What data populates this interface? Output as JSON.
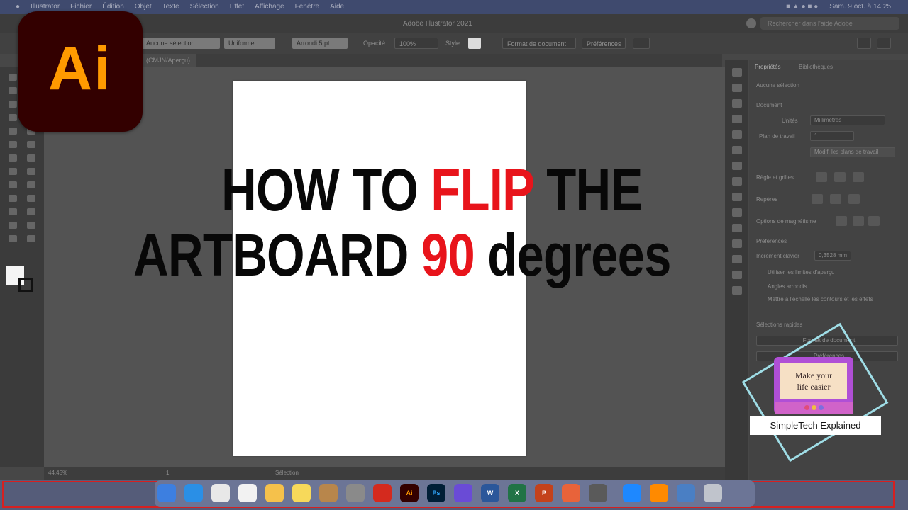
{
  "menubar": {
    "apple": "",
    "items": [
      "Illustrator",
      "Fichier",
      "Édition",
      "Objet",
      "Texte",
      "Sélection",
      "Effet",
      "Affichage",
      "Fenêtre",
      "Aide"
    ],
    "datetime": "Sam. 9 oct. à 14:25"
  },
  "window": {
    "title": "Adobe Illustrator 2021",
    "search_placeholder": "Rechercher dans l'aide Adobe"
  },
  "controlbar": {
    "fill_field": "Aucune sélection",
    "stroke_value": "Uniforme",
    "brush_value": "Arrondi 5 pt",
    "opacity_label": "Opacité",
    "opacity_value": "100%",
    "style_label": "Style",
    "doc_setup_button": "Format de document",
    "preferences_button": "Préférences"
  },
  "document_tab": {
    "label": "(CMJN/Aperçu)"
  },
  "statusbar": {
    "zoom": "44,45%",
    "artboard_number": "1",
    "selection_label": "Sélection"
  },
  "properties_panel": {
    "tabs": [
      "Propriétés",
      "Bibliothèques"
    ],
    "no_selection": "Aucune sélection",
    "document_section": "Document",
    "units_label": "Unités",
    "units_value": "Millimètres",
    "artboard_label": "Plan de travail",
    "artboard_value": "1",
    "edit_artboards_button": "Modif. les plans de travail",
    "rulers_grids_label": "Règle et grilles",
    "guides_label": "Repères",
    "snap_options_label": "Options de magnétisme",
    "preferences_section": "Préférences",
    "key_increment_label": "Incrément clavier",
    "key_increment_value": "0,3528 mm",
    "preview_bounds_label": "Utiliser les limites d'aperçu",
    "rounded_corners_label": "Angles arrondis",
    "scale_strokes_label": "Mettre à l'échelle les contours et les effets",
    "quick_actions_section": "Sélections rapides",
    "doc_setup_button": "Format de document",
    "preferences_button": "Préférences"
  },
  "logo": {
    "text": "Ai"
  },
  "headline": {
    "line1_a": "HOW TO ",
    "line1_accent": "FLIP",
    "line1_b": " THE",
    "line2_a": "ARTBOARD ",
    "line2_accent": "90",
    "line2_b": " degrees",
    "accent_color": "#e8141b"
  },
  "badge": {
    "screen_text_line1": "Make your",
    "screen_text_line2": "life easier",
    "caption": "SimpleTech Explained"
  },
  "dock": {
    "icons": [
      "finder-icon",
      "safari-icon",
      "chrome-icon",
      "calendar-icon",
      "photos-icon",
      "notes-icon",
      "folder-icon",
      "system-preferences-icon",
      "acrobat-icon",
      "illustrator-icon",
      "photoshop-icon",
      "imovie-icon",
      "word-icon",
      "excel-icon",
      "powerpoint-icon",
      "compass-icon",
      "calculator-icon",
      "app-store-icon",
      "vlc-icon",
      "preview-icon",
      "trash-icon"
    ],
    "illustrator_label": "Ai",
    "photoshop_label": "Ps",
    "word_label": "W",
    "excel_label": "X",
    "powerpoint_label": "P"
  }
}
